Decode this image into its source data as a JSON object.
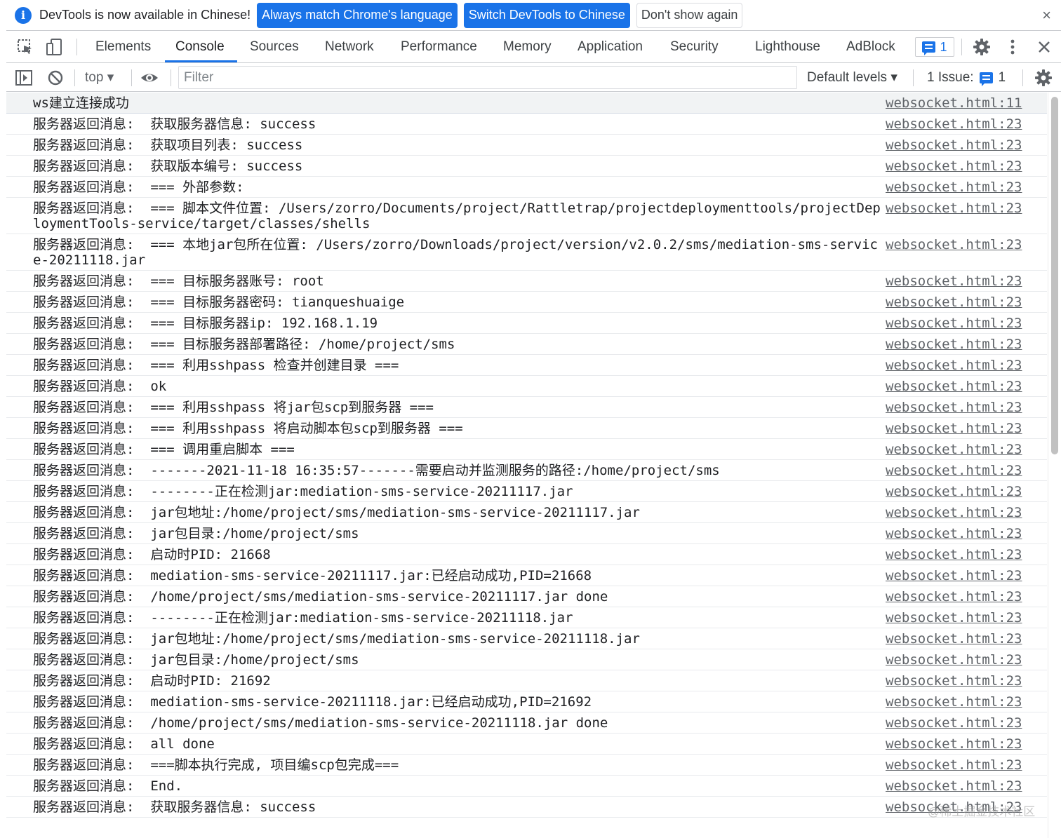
{
  "infobar": {
    "message": "DevTools is now available in Chinese!",
    "btn_match": "Always match Chrome's language",
    "btn_switch": "Switch DevTools to Chinese",
    "btn_dismiss": "Don't show again",
    "close": "×"
  },
  "tabs": [
    {
      "label": "Elements"
    },
    {
      "label": "Console"
    },
    {
      "label": "Sources"
    },
    {
      "label": "Network"
    },
    {
      "label": "Performance"
    },
    {
      "label": "Memory"
    },
    {
      "label": "Application"
    },
    {
      "label": "Security"
    },
    {
      "label": "Lighthouse"
    },
    {
      "label": "AdBlock"
    }
  ],
  "tabbar": {
    "issues_count": "1",
    "close": "×"
  },
  "toolbar": {
    "context": "top",
    "filter_placeholder": "Filter",
    "levels": "Default levels",
    "issues_label": "1 Issue:",
    "issues_count": "1"
  },
  "colors": {
    "accent": "#1a73e8"
  },
  "console": {
    "rows": [
      {
        "msg": "ws建立连接成功",
        "src": "websocket.html:11"
      },
      {
        "msg": "服务器返回消息:  获取服务器信息: success",
        "src": "websocket.html:23"
      },
      {
        "msg": "服务器返回消息:  获取项目列表: success",
        "src": "websocket.html:23"
      },
      {
        "msg": "服务器返回消息:  获取版本编号: success",
        "src": "websocket.html:23"
      },
      {
        "msg": "服务器返回消息:  === 外部参数:",
        "src": "websocket.html:23"
      },
      {
        "msg": "服务器返回消息:  === 脚本文件位置: /Users/zorro/Documents/project/Rattletrap/projectdeploymenttools/projectDeploymentTools-service/target/classes/shells",
        "src": "websocket.html:23"
      },
      {
        "msg": "服务器返回消息:  === 本地jar包所在位置: /Users/zorro/Downloads/project/version/v2.0.2/sms/mediation-sms-service-20211118.jar",
        "src": "websocket.html:23"
      },
      {
        "msg": "服务器返回消息:  === 目标服务器账号: root",
        "src": "websocket.html:23"
      },
      {
        "msg": "服务器返回消息:  === 目标服务器密码: tianqueshuaige",
        "src": "websocket.html:23"
      },
      {
        "msg": "服务器返回消息:  === 目标服务器ip: 192.168.1.19",
        "src": "websocket.html:23"
      },
      {
        "msg": "服务器返回消息:  === 目标服务器部署路径: /home/project/sms",
        "src": "websocket.html:23"
      },
      {
        "msg": "服务器返回消息:  === 利用sshpass 检查并创建目录 ===",
        "src": "websocket.html:23"
      },
      {
        "msg": "服务器返回消息:  ok",
        "src": "websocket.html:23"
      },
      {
        "msg": "服务器返回消息:  === 利用sshpass 将jar包scp到服务器 ===",
        "src": "websocket.html:23"
      },
      {
        "msg": "服务器返回消息:  === 利用sshpass 将启动脚本包scp到服务器 ===",
        "src": "websocket.html:23"
      },
      {
        "msg": "服务器返回消息:  === 调用重启脚本 ===",
        "src": "websocket.html:23"
      },
      {
        "msg": "服务器返回消息:  -------2021-11-18 16:35:57-------需要启动并监测服务的路径:/home/project/sms",
        "src": "websocket.html:23"
      },
      {
        "msg": "服务器返回消息:  --------正在检测jar:mediation-sms-service-20211117.jar",
        "src": "websocket.html:23"
      },
      {
        "msg": "服务器返回消息:  jar包地址:/home/project/sms/mediation-sms-service-20211117.jar",
        "src": "websocket.html:23"
      },
      {
        "msg": "服务器返回消息:  jar包目录:/home/project/sms",
        "src": "websocket.html:23"
      },
      {
        "msg": "服务器返回消息:  启动时PID: 21668",
        "src": "websocket.html:23"
      },
      {
        "msg": "服务器返回消息:  mediation-sms-service-20211117.jar:已经启动成功,PID=21668",
        "src": "websocket.html:23"
      },
      {
        "msg": "服务器返回消息:  /home/project/sms/mediation-sms-service-20211117.jar done",
        "src": "websocket.html:23"
      },
      {
        "msg": "服务器返回消息:  --------正在检测jar:mediation-sms-service-20211118.jar",
        "src": "websocket.html:23"
      },
      {
        "msg": "服务器返回消息:  jar包地址:/home/project/sms/mediation-sms-service-20211118.jar",
        "src": "websocket.html:23"
      },
      {
        "msg": "服务器返回消息:  jar包目录:/home/project/sms",
        "src": "websocket.html:23"
      },
      {
        "msg": "服务器返回消息:  启动时PID: 21692",
        "src": "websocket.html:23"
      },
      {
        "msg": "服务器返回消息:  mediation-sms-service-20211118.jar:已经启动成功,PID=21692",
        "src": "websocket.html:23"
      },
      {
        "msg": "服务器返回消息:  /home/project/sms/mediation-sms-service-20211118.jar done",
        "src": "websocket.html:23"
      },
      {
        "msg": "服务器返回消息:  all done",
        "src": "websocket.html:23"
      },
      {
        "msg": "服务器返回消息:  ===脚本执行完成, 项目编scp包完成===",
        "src": "websocket.html:23"
      },
      {
        "msg": "服务器返回消息:  End.",
        "src": "websocket.html:23"
      },
      {
        "msg": "服务器返回消息:  获取服务器信息: success",
        "src": "websocket.html:23"
      }
    ]
  },
  "watermark": "@稀土掘金技术社区"
}
